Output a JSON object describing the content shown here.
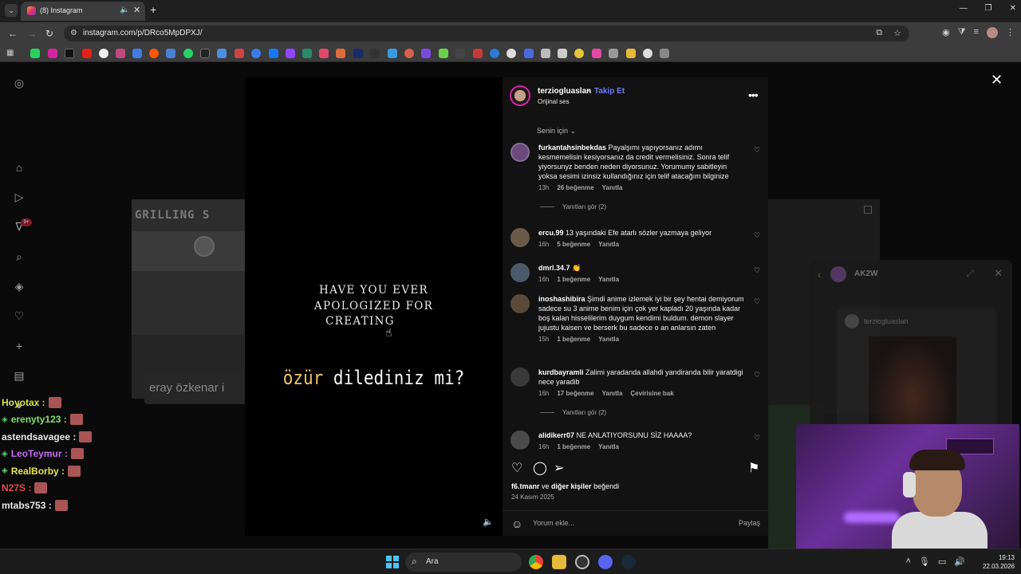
{
  "browser": {
    "tab_title": "(8) Instagram",
    "url": "instagram.com/p/DRco5MpDPXJ/"
  },
  "background": {
    "card_text": "GRILLING S",
    "search_text": "eray özkenar i",
    "dm_name": "AK2W",
    "dm_shared_user": "terziogluaslan"
  },
  "stream_chat": [
    {
      "user": "Hoyotax :",
      "color": "#d6e34a",
      "badge": false
    },
    {
      "user": "erenyty123 :",
      "color": "#7fe06a",
      "badge": true
    },
    {
      "user": "astendsavagee :",
      "color": "#e8e8e8",
      "badge": false
    },
    {
      "user": "LeoTeymur :",
      "color": "#c86af5",
      "badge": true
    },
    {
      "user": "RealBorby :",
      "color": "#e6e34a",
      "badge": true
    },
    {
      "user": "N27S :",
      "color": "#e64a4a",
      "badge": false
    },
    {
      "user": "mtabs753 :",
      "color": "#e8e8e8",
      "badge": false
    }
  ],
  "video": {
    "caption_en": [
      "HAVE YOU EVER",
      "APOLOGIZED FOR",
      "CREATING"
    ],
    "caption_tr_highlight": "özür",
    "caption_tr_rest": "dilediniz mi?"
  },
  "post": {
    "owner": "terziogluaslan",
    "follow_label": "Takip Et",
    "audio": "Orijinal ses",
    "for_you": "Senin için",
    "likes_user": "f6.tmanr",
    "likes_mid": " ve ",
    "likes_others": "diğer kişiler",
    "likes_suffix": " beğendi",
    "date": "24 Kasım 2025",
    "comment_placeholder": "Yorum ekle...",
    "share_label": "Paylaş"
  },
  "comments": [
    {
      "user": "furkantahsinbekdas",
      "text": "Payalşımı yapıyorsanız adımı kesmemelisin kesiyorsanız da credit vermelisiniz. Sonra telif yiyorsunyz benden neden diyorsunuz. Yorumumy sabitleyin yoksa sesimi izinsiz kullandığınız için telif atacağım bilginize",
      "time": "13h",
      "likes": "26 beğenme",
      "reply": "Yanıtla",
      "translate": "",
      "replies": "Yanıtları gör (2)"
    },
    {
      "user": "ercu.99",
      "text": "13 yaşındaki Efe atarlı sözler yazmaya geliyor",
      "time": "16h",
      "likes": "5 beğenme",
      "reply": "Yanıtla",
      "translate": "",
      "replies": ""
    },
    {
      "user": "dmrl.34.7",
      "text": "👏",
      "time": "16h",
      "likes": "1 beğenme",
      "reply": "Yanıtla",
      "translate": "",
      "replies": ""
    },
    {
      "user": "inoshashibira",
      "text": "Şimdi anime izlemek iyi bir şey hentai demiyorum sadece su 3 anime benim için çok yer kapladı 20 yaşında kadar boş kalan hisselilerim duygum kendimi buldum. demon slayer jujustu kaisen ve berserk bu sadece o an anlarsın zaten",
      "time": "15h",
      "likes": "1 beğenme",
      "reply": "Yanıtla",
      "translate": "",
      "replies": ""
    },
    {
      "user": "kurdbayramli",
      "text": "Zalimi yaradanda allahdi yandiranda bilir yaratdigi nece yaradib",
      "time": "16h",
      "likes": "17 beğenme",
      "reply": "Yanıtla",
      "translate": "Çevirisine bak",
      "replies": "Yanıtları gör (2)"
    },
    {
      "user": "alidikerr07",
      "text": "NE ANLATIYORSUNU SİZ HAAAA?",
      "time": "16h",
      "likes": "1 beğenme",
      "reply": "Yanıtla",
      "translate": "",
      "replies": ""
    }
  ],
  "taskbar": {
    "search_label": "Ara",
    "time": "19:13",
    "date": "22.03.2026"
  }
}
